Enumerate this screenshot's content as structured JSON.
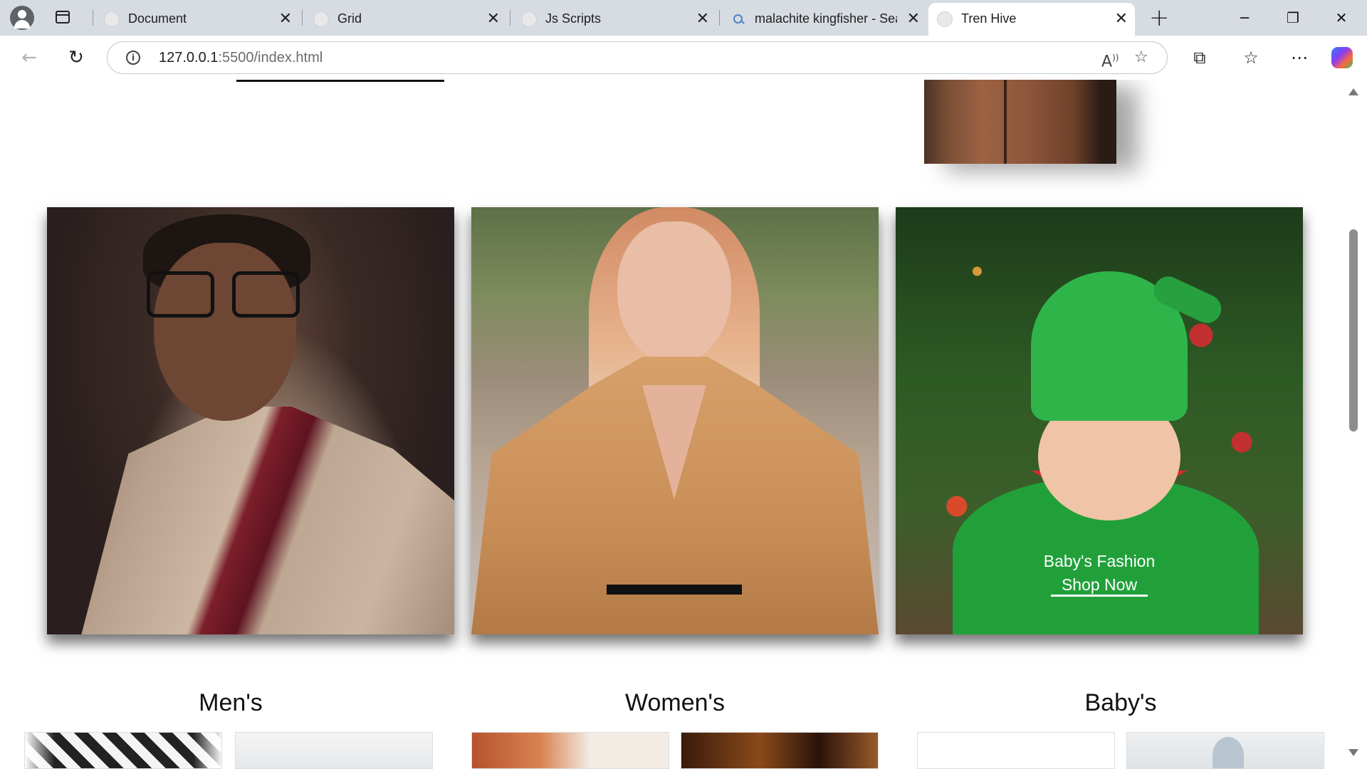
{
  "browser": {
    "tabs": [
      {
        "title": "Document",
        "active": false
      },
      {
        "title": "Grid",
        "active": false
      },
      {
        "title": "Js Scripts",
        "active": false
      },
      {
        "title": "malachite kingfisher - Sea",
        "active": false
      },
      {
        "title": "Tren Hive",
        "active": true
      }
    ],
    "close_glyph": "✕",
    "new_tab_glyph": "+",
    "url_host": "127.0.0.1",
    "url_path": ":5500/index.html",
    "icons": {
      "back": "back-arrow-icon",
      "reload": "reload-icon",
      "info": "site-info-icon",
      "read_aloud": "read-aloud-icon",
      "favorite": "star-icon",
      "extensions": "extensions-icon",
      "favorites": "favorites-icon",
      "menu": "more-icon",
      "copilot": "copilot-icon"
    }
  },
  "page": {
    "cards": [
      {
        "id": "men",
        "image": "man-in-beige-blazer-photo"
      },
      {
        "id": "women",
        "image": "woman-in-tan-coat-photo"
      },
      {
        "id": "baby",
        "image": "baby-in-elf-costume-photo",
        "caption": "Baby's Fashion",
        "cta": "Shop Now"
      }
    ],
    "categories": [
      "Men's",
      "Women's",
      "Baby's"
    ]
  }
}
